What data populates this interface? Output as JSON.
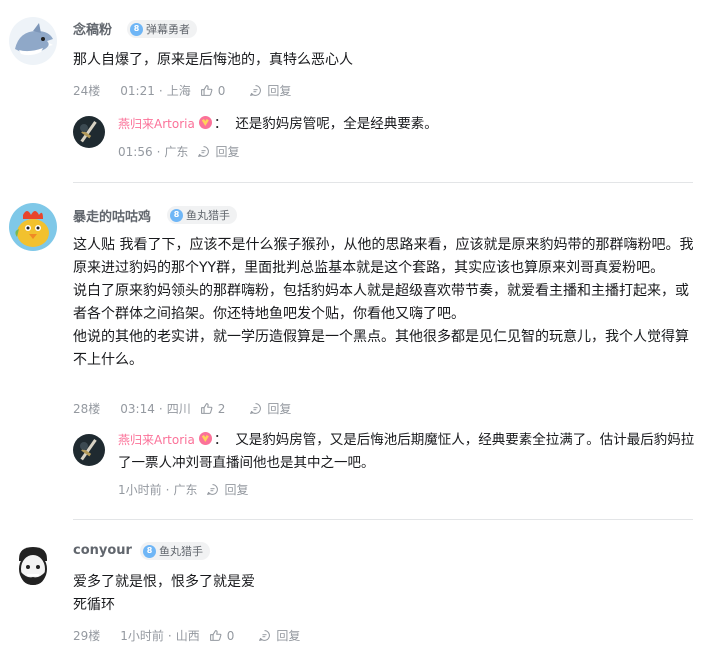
{
  "comments": [
    {
      "username": "念稿粉",
      "badge": "弹幕勇者",
      "content": [
        "那人自爆了，原来是后悔池的，真特么恶心人"
      ],
      "floor": "24楼",
      "time": "01:21",
      "location": "上海",
      "likes": "0",
      "reply_label": "回复",
      "sub": {
        "username": "燕归来Artoria",
        "text": "还是豹妈房管呢，全是经典要素。",
        "time": "01:56",
        "location": "广东",
        "reply_label": "回复"
      }
    },
    {
      "username": "暴走的咕咕鸡",
      "badge": "鱼丸猎手",
      "content": [
        "这人贴 我看了下，应该不是什么猴子猴孙，从他的思路来看，应该就是原来豹妈带的那群嗨粉吧。我原来进过豹妈的那个YY群，里面批判总监基本就是这个套路，其实应该也算原来刘哥真爱粉吧。",
        "说白了原来豹妈领头的那群嗨粉，包括豹妈本人就是超级喜欢带节奏，就爱看主播和主播打起来，或者各个群体之间掐架。你还特地鱼吧发个贴，你看他又嗨了吧。",
        "他说的其他的老实讲，就一学历造假算是一个黑点。其他很多都是见仁见智的玩意儿，我个人觉得算不上什么。"
      ],
      "floor": "28楼",
      "time": "03:14",
      "location": "四川",
      "likes": "2",
      "reply_label": "回复",
      "sub": {
        "username": "燕归来Artoria",
        "text": "又是豹妈房管，又是后悔池后期魔怔人，经典要素全拉满了。估计最后豹妈拉了一票人冲刘哥直播间他也是其中之一吧。",
        "time": "1小时前",
        "location": "广东",
        "reply_label": "回复"
      }
    },
    {
      "username": "conyour",
      "badge": "鱼丸猎手",
      "content": [
        "爱多了就是恨，恨多了就是爱",
        "死循环"
      ],
      "floor": "29楼",
      "time": "1小时前",
      "location": "山西",
      "likes": "0",
      "reply_label": "回复"
    }
  ],
  "separator": "·",
  "badge_level": "8",
  "colors": {
    "username": "#61666d",
    "vip_name": "#fb7299",
    "meta": "#9499a0",
    "badge_bg": "#f1f2f3",
    "badge_icon": "#6fb6f6"
  }
}
